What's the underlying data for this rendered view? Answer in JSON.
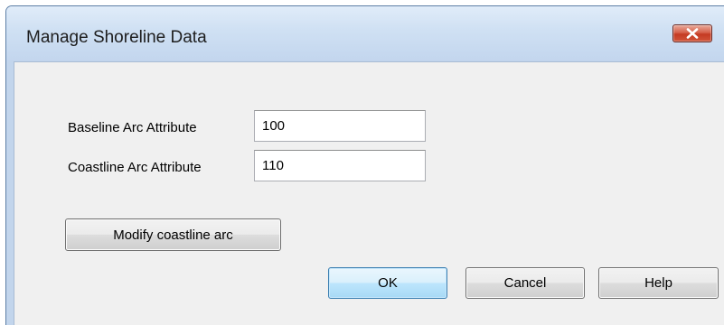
{
  "window": {
    "title": "Manage Shoreline Data",
    "close_icon": "close-icon"
  },
  "form": {
    "baseline": {
      "label": "Baseline Arc Attribute",
      "value": "100"
    },
    "coastline": {
      "label": "Coastline Arc Attribute",
      "value": "110"
    }
  },
  "buttons": {
    "modify": "Modify coastline arc",
    "ok": "OK",
    "cancel": "Cancel",
    "help": "Help"
  },
  "colors": {
    "window_frame": "#c2d5ec",
    "client_bg": "#f0f0f0",
    "close_button": "#c43a22",
    "default_button_border": "#3c7fb1"
  }
}
